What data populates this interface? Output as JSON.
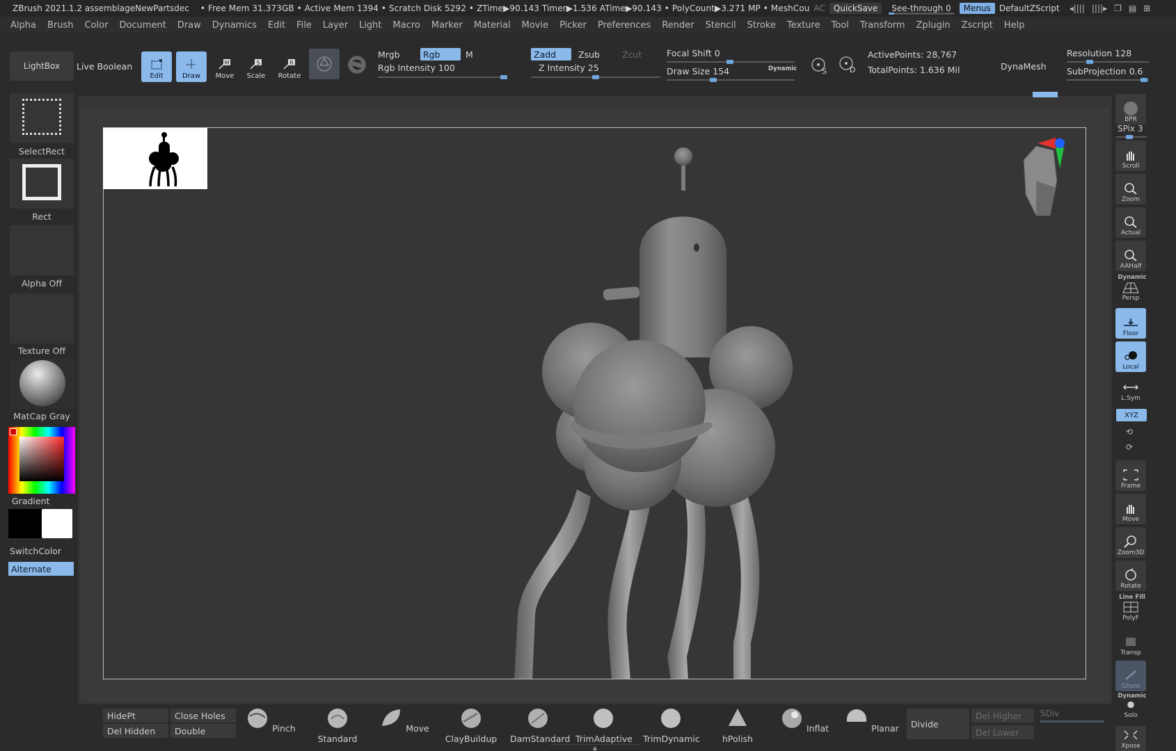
{
  "titlebar": {
    "title": "ZBrush 2021.1.2 assemblageNewPartsdec",
    "stats": "• Free Mem 31.373GB • Active Mem 1394 • Scratch Disk 5292 •  ZTime▶90.143 Timer▶1.536 ATime▶90.143 • PolyCount▶3.271 MP  • MeshCou",
    "ac": "AC",
    "quicksave": "QuickSave",
    "seethrough": "See-through  0",
    "menus": "Menus",
    "zscript": "DefaultZScript"
  },
  "menus": [
    "Alpha",
    "Brush",
    "Color",
    "Document",
    "Draw",
    "Dynamics",
    "Edit",
    "File",
    "Layer",
    "Light",
    "Macro",
    "Marker",
    "Material",
    "Movie",
    "Picker",
    "Preferences",
    "Render",
    "Stencil",
    "Stroke",
    "Texture",
    "Tool",
    "Transform",
    "Zplugin",
    "Zscript",
    "Help"
  ],
  "shelf": {
    "lightbox": "LightBox",
    "live_boolean": "Live Boolean",
    "edit": "Edit",
    "draw": "Draw",
    "move": "Move",
    "scale": "Scale",
    "rotate": "Rotate",
    "mrgb": "Mrgb",
    "rgb": "Rgb",
    "m": "M",
    "rgb_intensity": "Rgb Intensity 100",
    "zadd": "Zadd",
    "zsub": "Zsub",
    "zcut": "Zcut",
    "z_intensity": "Z Intensity 25",
    "focal_shift": "Focal Shift 0",
    "draw_size": "Draw Size 154",
    "dynamic": "Dynamic",
    "active_points": "ActivePoints: 28,767",
    "total_points": "TotalPoints: 1.636 Mil",
    "dynamesh": "DynaMesh",
    "resolution": "Resolution 128",
    "subprojection": "SubProjection 0.6",
    "s_label": "S",
    "d_label": "D"
  },
  "left": {
    "selectrect": "SelectRect",
    "rect": "Rect",
    "alpha": "Alpha Off",
    "texture": "Texture Off",
    "matcap": "MatCap Gray",
    "gradient": "Gradient",
    "switchcolor": "SwitchColor",
    "alternate": "Alternate"
  },
  "right": {
    "bpr": "BPR",
    "spix": "SPix 3",
    "scroll": "Scroll",
    "zoom": "Zoom",
    "actual": "Actual",
    "aahalf": "AAHalf",
    "dynamic": "Dynamic",
    "persp": "Persp",
    "floor": "Floor",
    "local": "Local",
    "lsym": "L.Sym",
    "xyz": "XYZ",
    "frame": "Frame",
    "move": "Move",
    "zoom3d": "Zoom3D",
    "rotate": "Rotate",
    "linefill": "Line Fill",
    "polyf": "PolyF",
    "transp": "Transp",
    "ghost": "Ghost",
    "dynamic2": "Dynamic",
    "solo": "Solo",
    "xpose": "Xpose"
  },
  "bottom": {
    "hidept": "HidePt",
    "del_hidden": "Del Hidden",
    "close_holes": "Close Holes",
    "double": "Double",
    "divide": "Divide",
    "del_higher": "Del Higher",
    "del_lower": "Del Lower",
    "sdiv": "SDiv",
    "brushes": [
      "Pinch",
      "Standard",
      "Move",
      "ClayBuildup",
      "DamStandard",
      "TrimAdaptive",
      "TrimDynamic",
      "hPolish",
      "Inflat",
      "Planar"
    ]
  },
  "colors": {
    "accent": "#8ab9ea",
    "panel": "#2b2b2b",
    "canvas": "#363636"
  }
}
